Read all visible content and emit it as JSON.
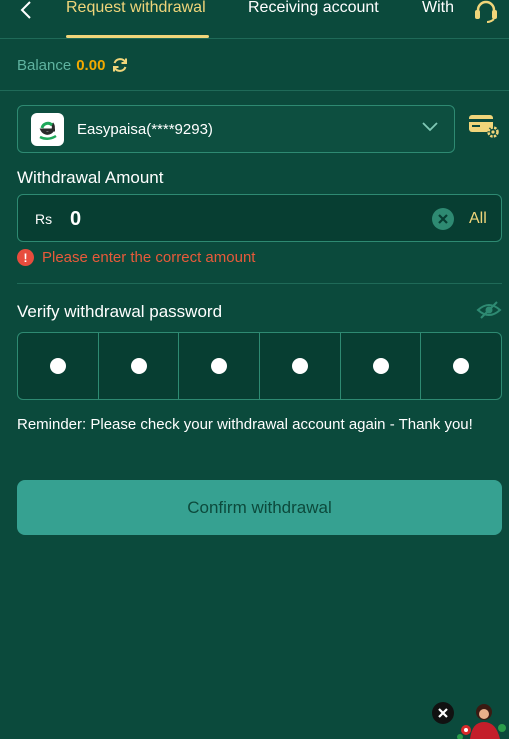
{
  "tabs": [
    {
      "label": "Request withdrawal",
      "active": true
    },
    {
      "label": "Receiving account",
      "active": false
    },
    {
      "label": "With",
      "active": false
    }
  ],
  "icons": {
    "back": "chevron-left-icon",
    "support": "headset-icon",
    "refresh": "refresh-icon",
    "wallet": "easypaisa-logo",
    "chevron": "chevron-down-icon",
    "card_settings": "card-settings-icon",
    "clear": "close-circle-icon",
    "error": "exclamation-circle-icon",
    "eye": "eye-off-icon",
    "promo_close": "close-icon"
  },
  "balance": {
    "label": "Balance",
    "value": "0.00"
  },
  "account": {
    "name": "Easypaisa(****9293)"
  },
  "amount": {
    "title": "Withdrawal Amount",
    "currency": "Rs",
    "value": "0",
    "all_label": "All",
    "error": "Please enter the correct amount"
  },
  "password": {
    "title": "Verify withdrawal password",
    "digits_entered": 6
  },
  "reminder": "Reminder: Please check your withdrawal account again - Thank you!",
  "confirm_label": "Confirm withdrawal",
  "colors": {
    "background": "#0b4a3c",
    "accent": "#f0d57a",
    "balance_value": "#f2a900",
    "button": "#36a191",
    "error": "#e85a3a"
  }
}
